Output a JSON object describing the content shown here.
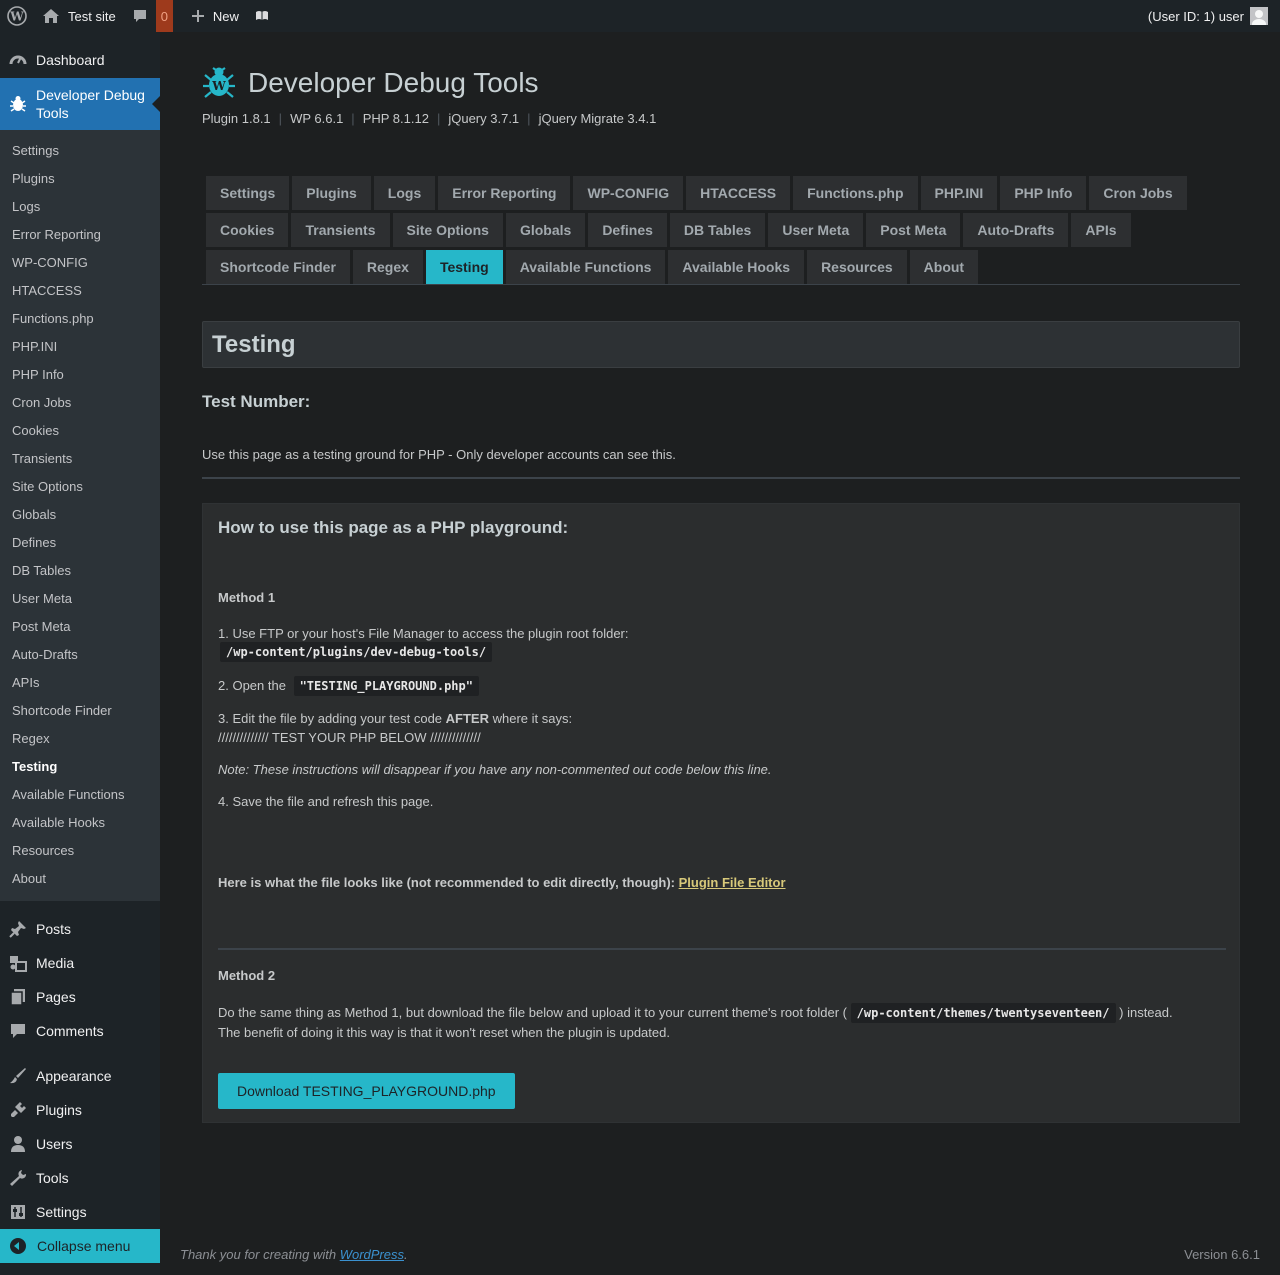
{
  "adminbar": {
    "site_name": "Test site",
    "comments_count": "0",
    "new_label": "New",
    "user_label": "(User ID: 1) user"
  },
  "sidebar": {
    "dashboard": "Dashboard",
    "current_plugin": "Developer Debug Tools",
    "submenu": [
      "Settings",
      "Plugins",
      "Logs",
      "Error Reporting",
      "WP-CONFIG",
      "HTACCESS",
      "Functions.php",
      "PHP.INI",
      "PHP Info",
      "Cron Jobs",
      "Cookies",
      "Transients",
      "Site Options",
      "Globals",
      "Defines",
      "DB Tables",
      "User Meta",
      "Post Meta",
      "Auto-Drafts",
      "APIs",
      "Shortcode Finder",
      "Regex",
      "Testing",
      "Available Functions",
      "Available Hooks",
      "Resources",
      "About"
    ],
    "current_sub": "Testing",
    "menu": [
      {
        "label": "Posts",
        "icon": "pushpin-icon"
      },
      {
        "label": "Media",
        "icon": "media-icon"
      },
      {
        "label": "Pages",
        "icon": "pages-icon"
      },
      {
        "label": "Comments",
        "icon": "comments-icon"
      },
      {
        "label": "Appearance",
        "icon": "paintbrush-icon"
      },
      {
        "label": "Plugins",
        "icon": "plug-icon"
      },
      {
        "label": "Users",
        "icon": "users-icon"
      },
      {
        "label": "Tools",
        "icon": "wrench-icon"
      },
      {
        "label": "Settings",
        "icon": "settings-icon"
      }
    ],
    "collapse": "Collapse menu"
  },
  "header": {
    "title": "Developer Debug Tools",
    "versions": [
      "Plugin 1.8.1",
      "WP 6.6.1",
      "PHP 8.1.12",
      "jQuery 3.7.1",
      "jQuery Migrate 3.4.1"
    ]
  },
  "tabs": {
    "rows": [
      [
        "Settings",
        "Plugins",
        "Logs",
        "Error Reporting",
        "WP-CONFIG",
        "HTACCESS",
        "Functions.php",
        "PHP.INI",
        "PHP Info",
        "Cron Jobs"
      ],
      [
        "Cookies",
        "Transients",
        "Site Options",
        "Globals",
        "Defines",
        "DB Tables",
        "User Meta",
        "Post Meta",
        "Auto-Drafts",
        "APIs"
      ],
      [
        "Shortcode Finder",
        "Regex",
        "Testing",
        "Available Functions",
        "Available Hooks",
        "Resources",
        "About"
      ]
    ],
    "active": "Testing"
  },
  "content": {
    "heading": "Testing",
    "test_number": "Test Number:",
    "intro": "Use this page as a testing ground for PHP - Only developer accounts can see this.",
    "panel_title": "How to use this page as a PHP playground:",
    "method1": "Method 1",
    "step1_text": "1. Use FTP or your host's File Manager to access the plugin root folder:",
    "step1_code": "/wp-content/plugins/dev-debug-tools/",
    "step2_text": "2. Open the",
    "step2_code": "\"TESTING_PLAYGROUND.php\"",
    "step3_pre": "3. Edit the file by adding your test code",
    "step3_bold": "AFTER",
    "step3_post": "where it says:",
    "step3_comment": "////////////// TEST YOUR PHP BELOW //////////////",
    "note": "Note: These instructions will disappear if you have any non-commented out code below this line.",
    "step4": "4. Save the file and refresh this page.",
    "file_looks": "Here is what the file looks like (not recommended to edit directly, though):",
    "file_editor_link": "Plugin File Editor",
    "method2": "Method 2",
    "m2_pre": "Do the same thing as Method 1, but download the file below and upload it to your current theme's root folder (",
    "m2_code": "/wp-content/themes/twentyseventeen/",
    "m2_post": ") instead.",
    "m2_line2": "The benefit of doing it this way is that it won't reset when the plugin is updated.",
    "download_button": "Download TESTING_PLAYGROUND.php"
  },
  "footer": {
    "thanks_pre": "Thank you for creating with",
    "thanks_link": "WordPress",
    "thanks_post": ".",
    "version": "Version 6.6.1"
  },
  "colors": {
    "accent": "#26b7c9",
    "admin_blue": "#2271b1",
    "background": "#1d1f20"
  }
}
